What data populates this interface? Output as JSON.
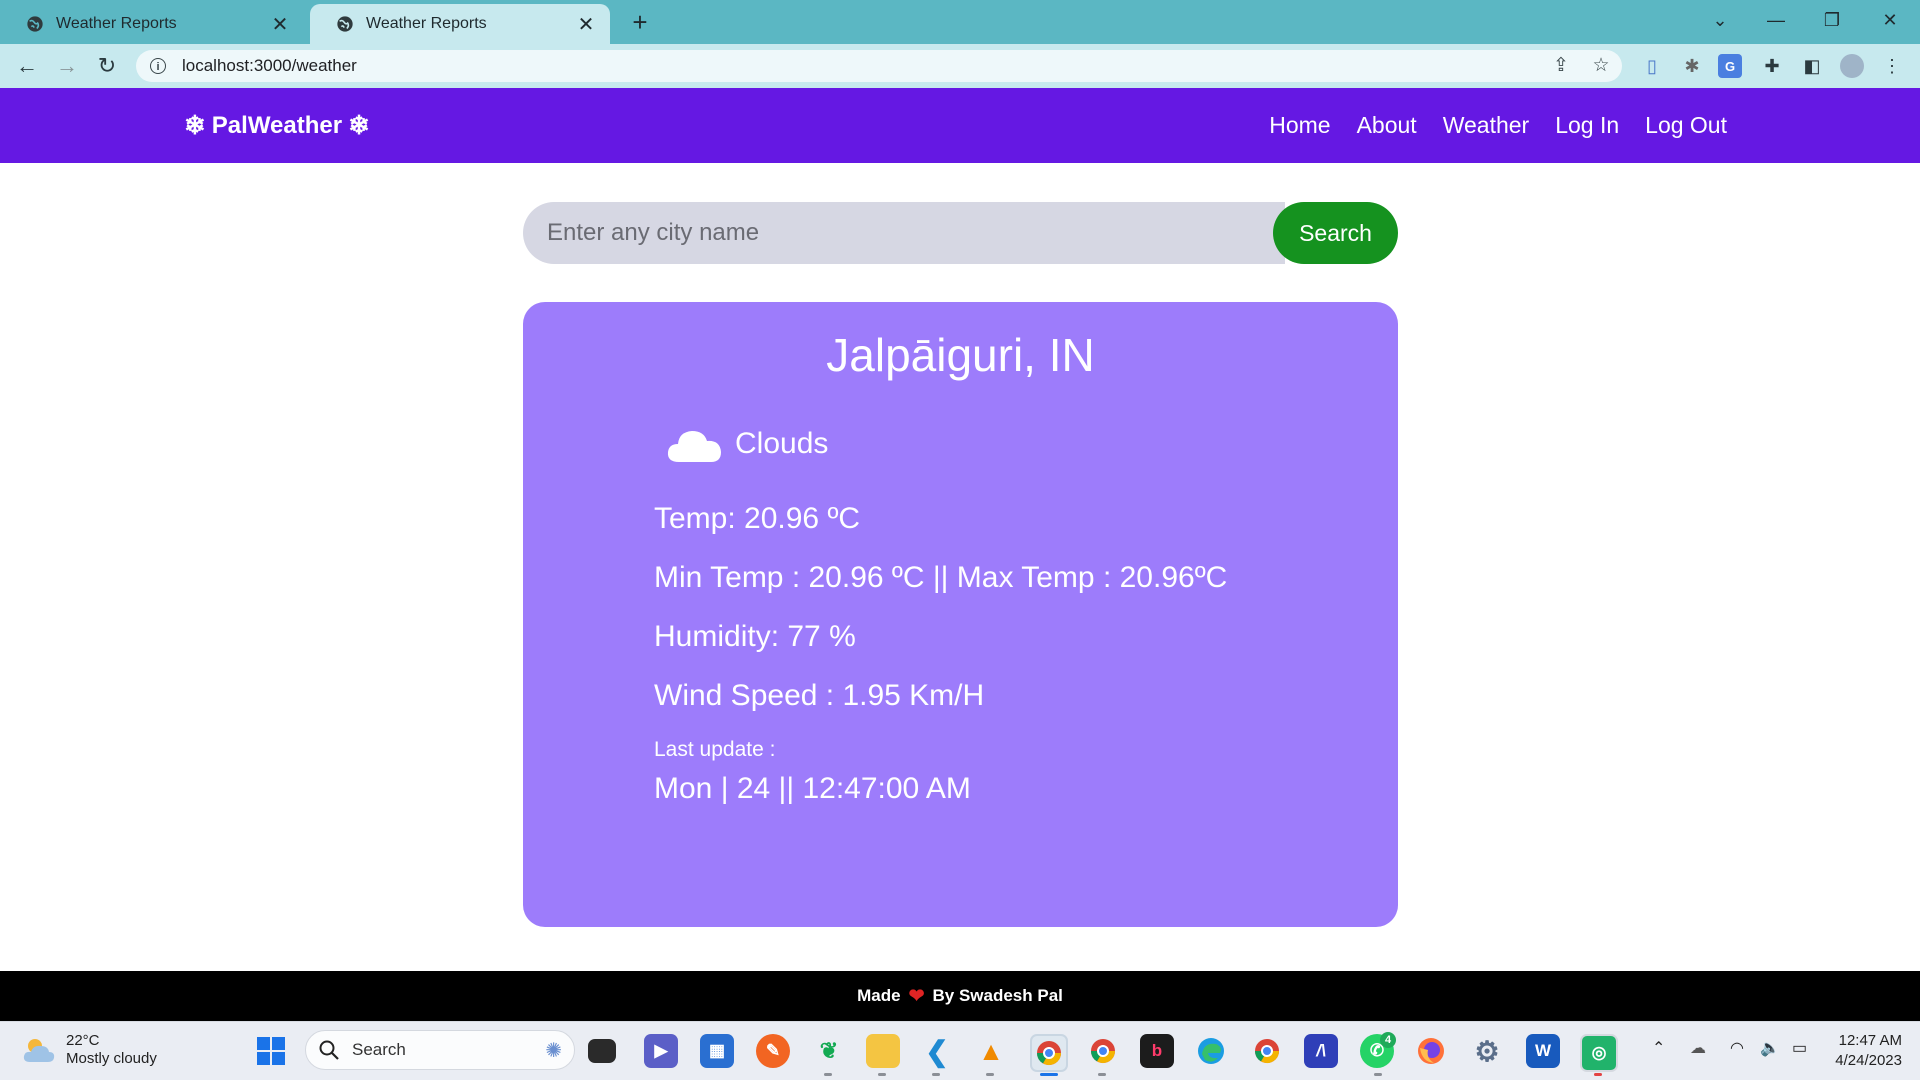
{
  "browser": {
    "tabs": [
      {
        "title": "Weather Reports",
        "active": false
      },
      {
        "title": "Weather Reports",
        "active": true
      }
    ],
    "url": "localhost:3000/weather",
    "window_controls": {
      "dropdown": "⌄",
      "minimize": "—",
      "restore": "❐",
      "close": "✕"
    }
  },
  "navbar": {
    "brand": "PalWeather",
    "brand_icon": "❄",
    "links": [
      "Home",
      "About",
      "Weather",
      "Log In",
      "Log Out"
    ],
    "background": "#6518e3"
  },
  "search": {
    "placeholder": "Enter any city name",
    "button": "Search",
    "button_color": "#15921f"
  },
  "weather": {
    "city": "Jalpāiguri, IN",
    "condition": "Clouds",
    "temp": "Temp: 20.96 ºC",
    "minmax": "Min Temp : 20.96 ºC || Max Temp : 20.96ºC",
    "humidity": "Humidity: 77 %",
    "wind": "Wind Speed : 1.95 Km/H",
    "last_update_label": "Last update :",
    "last_update_value": "Mon | 24 || 12:47:00 AM",
    "card_color": "#9d7cfb"
  },
  "footer": {
    "made": "Made",
    "heart": "❤",
    "by": "By Swadesh Pal"
  },
  "taskbar": {
    "weather_temp": "22°C",
    "weather_desc": "Mostly cloudy",
    "search": "Search",
    "whatsapp_badge": "4",
    "time": "12:47 AM",
    "date": "4/24/2023"
  }
}
